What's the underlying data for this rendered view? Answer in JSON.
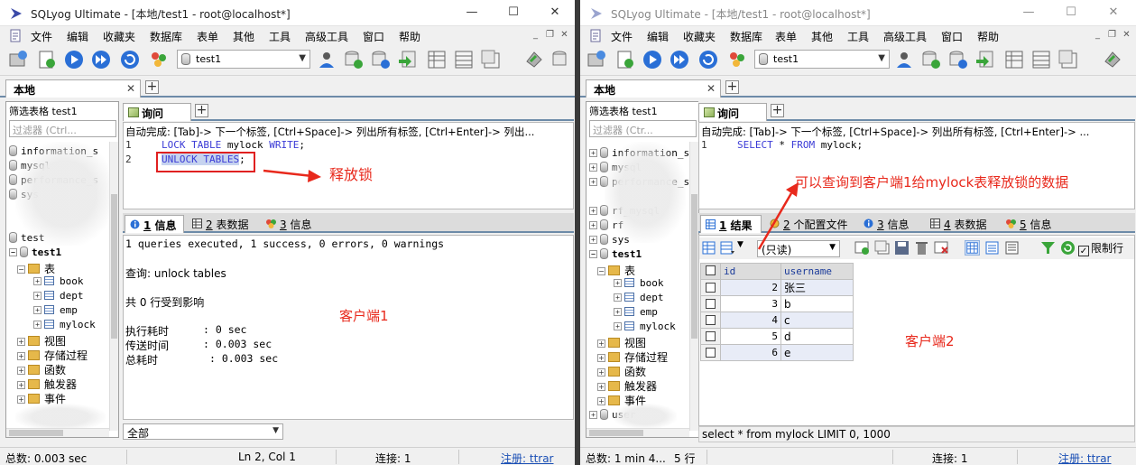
{
  "client1": {
    "title": "SQLyog Ultimate - [本地/test1 - root@localhost*]",
    "menu": [
      "文件",
      "编辑",
      "收藏夹",
      "数据库",
      "表单",
      "其他",
      "工具",
      "高级工具",
      "窗口",
      "帮助"
    ],
    "db_select": "test1",
    "conn_tab": "本地",
    "left": {
      "header": "筛选表格 test1",
      "filter_placeholder": "过滤器 (Ctrl...",
      "db_top": [
        "information_s",
        "mysql",
        "performance_s",
        "sys",
        "test"
      ],
      "db": "test1",
      "tables_folder": "表",
      "tables": [
        "book",
        "dept",
        "emp",
        "mylock"
      ],
      "folders": [
        "视图",
        "存储过程",
        "函数",
        "触发器",
        "事件"
      ]
    },
    "query_tab": "询问",
    "autocomplete": "自动完成: [Tab]-> 下一个标签, [Ctrl+Space]-> 列出所有标签, [Ctrl+Enter]-> 列出...",
    "code": {
      "l1_num": "1",
      "l1_kw": "LOCK TABLE",
      "l1_name": " mylock ",
      "l1_kw2": "WRITE",
      "l1_end": ";",
      "l2_num": "2",
      "l2_text": "UNLOCK TABLES",
      "l2_end": ";"
    },
    "result_tabs": [
      {
        "num": "1",
        "label": " 信息"
      },
      {
        "num": "2",
        "label": " 表数据"
      },
      {
        "num": "3",
        "label": " 信息"
      }
    ],
    "messages": {
      "summary": "1 queries executed, 1 success, 0 errors, 0 warnings",
      "query": "查询: unlock tables",
      "affected": "共 0 行受到影响",
      "exec_label": "执行耗时",
      "exec_val": ": 0 sec",
      "transfer_label": "传送时间",
      "transfer_val": ": 0.003 sec",
      "total_label": "总耗时",
      "total_val": ": 0.003 sec"
    },
    "bottom_select": "全部",
    "status": {
      "total": "总数: 0.003 sec",
      "pos": "Ln 2, Col 1",
      "conn": "连接: 1",
      "reg": "注册: ttrar"
    },
    "annot_release": "释放锁",
    "annot_client": "客户端1"
  },
  "client2": {
    "title": "SQLyog Ultimate - [本地/test1 - root@localhost*]",
    "menu": [
      "文件",
      "编辑",
      "收藏夹",
      "数据库",
      "表单",
      "其他",
      "工具",
      "高级工具",
      "窗口",
      "帮助"
    ],
    "db_select": "test1",
    "conn_tab": "本地",
    "left": {
      "header": "筛选表格 test1",
      "filter_placeholder": "过滤器 (Ctr...",
      "db_top": [
        "information_schema",
        "mysql",
        "performance_schema",
        "rf_mysql",
        "rf",
        "sys"
      ],
      "db": "test1",
      "tables_folder": "表",
      "tables": [
        "book",
        "dept",
        "emp",
        "mylock"
      ],
      "folders": [
        "视图",
        "存储过程",
        "函数",
        "触发器",
        "事件"
      ],
      "db_bottom": "user"
    },
    "query_tab": "询问",
    "autocomplete": "自动完成: [Tab]-> 下一个标签, [Ctrl+Space]-> 列出所有标签, [Ctrl+Enter]-> ...",
    "code": {
      "l1_num": "1",
      "l1_kw": "SELECT",
      "l1_star": " * ",
      "l1_kw2": "FROM",
      "l1_rest": " mylock;"
    },
    "result_tabs": [
      {
        "num": "1",
        "label": " 结果"
      },
      {
        "num": "2",
        "label": " 个配置文件"
      },
      {
        "num": "3",
        "label": " 信息"
      },
      {
        "num": "4",
        "label": " 表数据"
      },
      {
        "num": "5",
        "label": " 信息"
      }
    ],
    "readonly": "(只读)",
    "limit_rows": "限制行",
    "grid": {
      "columns": [
        "id",
        "username"
      ],
      "rows": [
        [
          "2",
          "张三"
        ],
        [
          "3",
          "b"
        ],
        [
          "4",
          "c"
        ],
        [
          "5",
          "d"
        ],
        [
          "6",
          "e"
        ]
      ]
    },
    "sql_status": "select * from mylock LIMIT 0, 1000",
    "status": {
      "total": "总数: 1 min 4...",
      "rows": "5 行",
      "conn": "连接: 1",
      "reg": "注册: ttrar"
    },
    "annot_data": "可以查询到客户端1给mylock表释放锁的数据",
    "annot_client": "客户端2"
  }
}
